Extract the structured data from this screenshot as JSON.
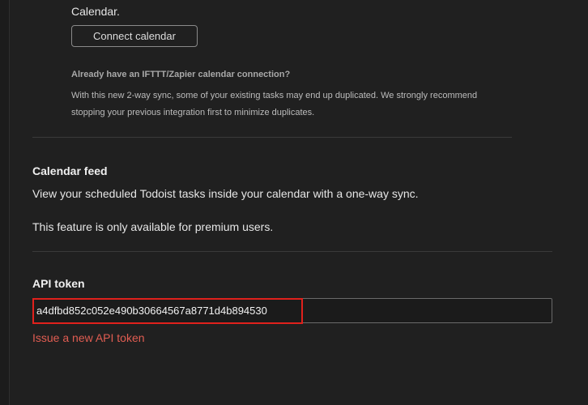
{
  "integrations": {
    "calendar_sync_text_end": "Calendar.",
    "connect_button_label": "Connect calendar",
    "existing_connection_title": "Already have an IFTTT/Zapier calendar connection?",
    "existing_connection_note_line1": "With this new 2-way sync, some of your existing tasks may end up duplicated. We strongly recommend",
    "existing_connection_note_line2": "stopping your previous integration first to minimize duplicates."
  },
  "calendar_feed": {
    "heading": "Calendar feed",
    "description": "View your scheduled Todoist tasks inside your calendar with a one-way sync.",
    "premium_note": "This feature is only available for premium users."
  },
  "api_token": {
    "heading": "API token",
    "value": "a4dfbd852c052e490b30664567a8771d4b894530",
    "issue_link": "Issue a new API token"
  },
  "colors": {
    "background": "#202020",
    "link": "#e15d52",
    "highlight": "#e0211c"
  }
}
